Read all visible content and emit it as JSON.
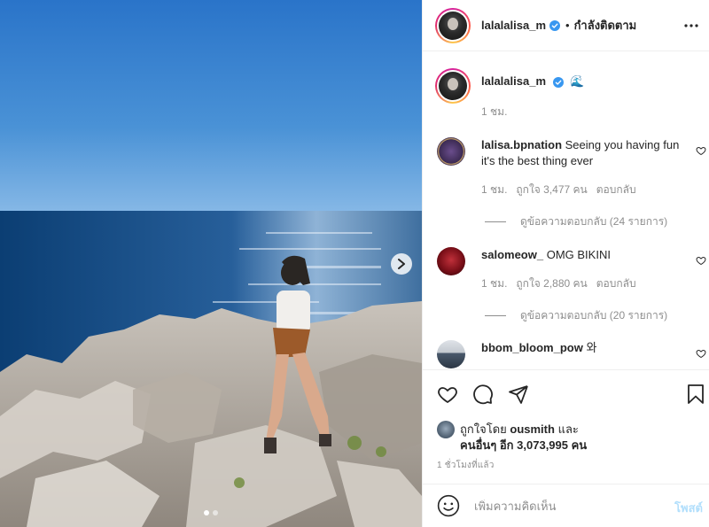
{
  "post": {
    "image_alt": "photo",
    "carousel": {
      "total": 2,
      "active": 0
    }
  },
  "header": {
    "username": "lalalalisa_m",
    "separator": "•",
    "follow_status": "กำลังติดตาม"
  },
  "caption": {
    "username": "lalalalisa_m",
    "emoji": "🌊",
    "time": "1 ชม."
  },
  "comments": [
    {
      "username": "lalisa.bpnation",
      "text": "Seeing you having fun it's the best thing ever",
      "time": "1 ชม.",
      "likes": "ถูกใจ 3,477 คน",
      "reply": "ตอบกลับ",
      "view_replies": "ดูข้อความตอบกลับ (24 รายการ)"
    },
    {
      "username": "salomeow_",
      "text": "OMG BIKINI",
      "time": "1 ชม.",
      "likes": "ถูกใจ 2,880 คน",
      "reply": "ตอบกลับ",
      "view_replies": "ดูข้อความตอบกลับ (20 รายการ)"
    },
    {
      "username": "bbom_bloom_pow",
      "text": "와"
    }
  ],
  "likes": {
    "prefix": "ถูกใจโดย",
    "liker": "ousmith",
    "and": "และ",
    "others_line": "คนอื่นๆ อีก 3,073,995 คน",
    "others_count": "3,073,995"
  },
  "timestamp": "1 ชั่วโมงที่แล้ว",
  "add_comment": {
    "placeholder": "เพิ่มความคิดเห็น",
    "post_label": "โพสต์"
  },
  "colors": {
    "verified": "#3897f0",
    "link_disabled": "#b2dffc",
    "muted": "#8e8e8e",
    "text": "#262626"
  }
}
